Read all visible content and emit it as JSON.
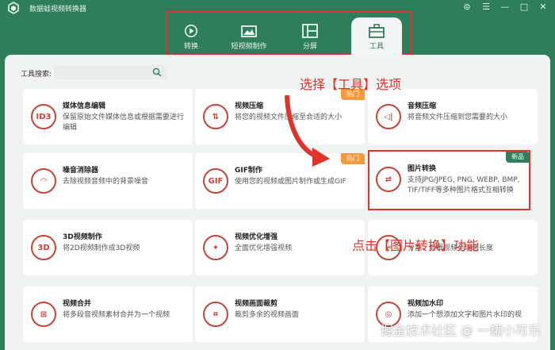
{
  "app": {
    "title": "数据蛙视频转换器"
  },
  "window_controls": {
    "menu": "⊜",
    "list": "☰",
    "minimize": "—",
    "maximize": "□",
    "close": "✕"
  },
  "tabs": [
    {
      "label": "转换",
      "icon": "convert-icon"
    },
    {
      "label": "短视频制作",
      "icon": "short-video-icon"
    },
    {
      "label": "分屏",
      "icon": "split-screen-icon"
    },
    {
      "label": "工具",
      "icon": "toolbox-icon",
      "active": true
    }
  ],
  "search": {
    "label": "工具搜索:",
    "placeholder": ""
  },
  "tools": [
    {
      "title": "媒体信息编辑",
      "desc": "保留原始文件媒体信息或根据需要进行编辑",
      "icon_text": "ID3"
    },
    {
      "title": "视频压缩",
      "desc": "将您的视频文件压缩至合适的大小",
      "icon_text": "⇅",
      "badge": "热门"
    },
    {
      "title": "音频压缩",
      "desc": "将音频文件压缩到您需要的大小",
      "icon_text": "◁|"
    },
    {
      "title": "噪音消除器",
      "desc": "去除视频音频中的背景噪音",
      "icon_text": "◠"
    },
    {
      "title": "GIF制作",
      "desc": "使用您的视频或图片制作或生成GIF",
      "icon_text": "GIF",
      "badge": "热门"
    },
    {
      "title": "图片转换",
      "desc": "支持JPG/JPEG, PNG, WEBP, BMP, TIF/TIFF等多种图片格式互相转换",
      "icon_text": "⇄",
      "badge": "新品"
    },
    {
      "title": "3D视频制作",
      "desc": "将2D视频制作成3D视频",
      "icon_text": "3D"
    },
    {
      "title": "视频优化增强",
      "desc": "全面优化增强视频",
      "icon_text": "✦"
    },
    {
      "title": "",
      "desc": "分割、剪辑视频至理想长度",
      "icon_text": "✂"
    },
    {
      "title": "视频合并",
      "desc": "将多段音视频素材合并为一个视频",
      "icon_text": "⊞"
    },
    {
      "title": "视频画面裁剪",
      "desc": "裁剪多余的视频画面",
      "icon_text": "⌗"
    },
    {
      "title": "视频加水印",
      "desc": "添加一个想添加文字和图片水印的视",
      "icon_text": "◎"
    }
  ],
  "annotations": {
    "select_tools": "选择【工具】选项",
    "click_convert": "点击【图片转换】功能"
  },
  "watermark": "掘金技术社区 @ 一罐小可乐",
  "colors": {
    "brand_green": "#2e7d5b",
    "highlight_red": "#e0342b",
    "hot_orange": "#f19a3e"
  }
}
